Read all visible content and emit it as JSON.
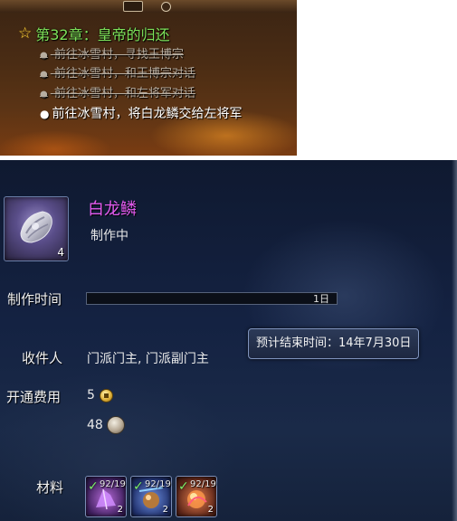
{
  "quest": {
    "title": "第32章：皇帝的归还",
    "steps": [
      {
        "text": "前往冰雪村，寻找王博宗",
        "done": true
      },
      {
        "text": "前往冰雪村，和王博宗对话",
        "done": true
      },
      {
        "text": "前往冰雪村，和左将军对话",
        "done": true
      },
      {
        "text": "前往冰雪村，将白龙鳞交给左将军",
        "done": false
      }
    ]
  },
  "craft": {
    "item_name": "白龙鳞",
    "item_count": "4",
    "status": "制作中",
    "time_label": "制作时间",
    "time_value": "1日",
    "progress": 0.0,
    "eta_text": "预计结束时间：14年7月30日",
    "recipient_label": "收件人",
    "recipient_value": "门派门主, 门派副门主",
    "fee_label": "开通费用",
    "fee_gold": "5",
    "fee_silver": "48",
    "materials_label": "材料",
    "materials": [
      {
        "progress": "92/19",
        "need": "2",
        "icon": "purple-crystal-icon",
        "color": "#7a3fb0"
      },
      {
        "progress": "92/19",
        "need": "2",
        "icon": "blue-orb-icon",
        "color": "#3f5fb0"
      },
      {
        "progress": "92/19",
        "need": "2",
        "icon": "fire-crystal-icon",
        "color": "#b0402f"
      }
    ]
  },
  "colors": {
    "quest_title": "#7fe35a",
    "item_name": "#e35bf0",
    "panel_bg": "#142242"
  }
}
